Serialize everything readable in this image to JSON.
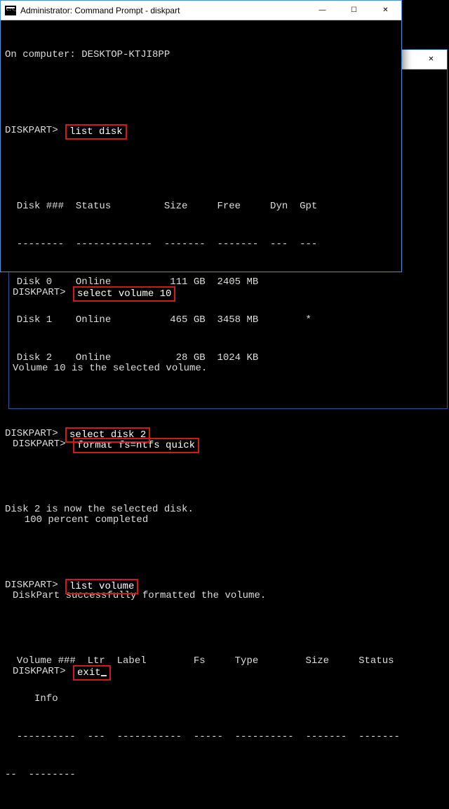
{
  "front": {
    "title": "Administrator: Command Prompt - diskpart",
    "btn_min": "—",
    "btn_max": "☐",
    "btn_close": "✕",
    "line_oncomputer": "On computer: DESKTOP-KTJI8PP",
    "prompt": "DISKPART>",
    "cmd_listdisk": "list disk",
    "disk_header": "  Disk ###  Status         Size     Free     Dyn  Gpt",
    "disk_dashes": "  --------  -------------  -------  -------  ---  ---",
    "disk_rows": [
      "  Disk 0    Online          111 GB  2405 MB",
      "  Disk 1    Online          465 GB  3458 MB        *",
      "  Disk 2    Online           28 GB  1024 KB"
    ],
    "cmd_selectdisk": "select disk 2",
    "msg_selectdisk": "Disk 2 is now the selected disk.",
    "cmd_listvolume": "list volume",
    "vol_header1": "  Volume ###  Ltr  Label        Fs     Type        Size     Status",
    "vol_header2": "     Info",
    "vol_dashes1": "  ----------  ---  -----------  -----  ----------  -------  -------",
    "vol_dashes2": "--  --------"
  },
  "back": {
    "btn_min": "—",
    "btn_max": "☐",
    "btn_close": "✕",
    "prompt": "DISKPART>",
    "cmd_selectvol": "select volume 10",
    "msg_selectvol": "Volume 10 is the selected volume.",
    "cmd_format": "format fs=ntfs quick",
    "msg_percent": "  100 percent completed",
    "msg_success": "DiskPart successfully formatted the volume.",
    "cmd_exit": "exit"
  }
}
